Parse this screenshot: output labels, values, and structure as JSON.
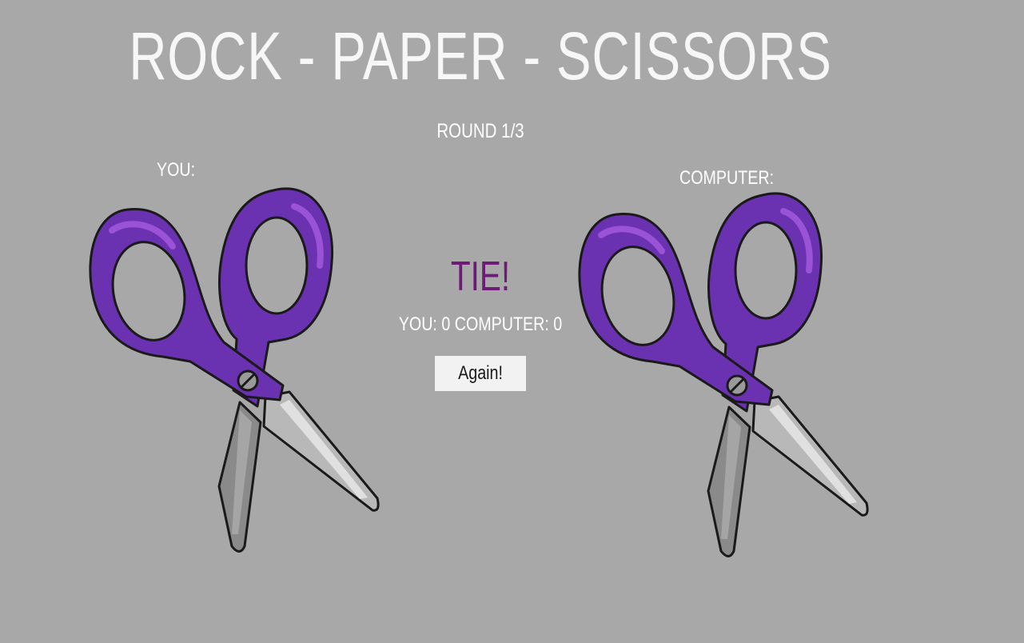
{
  "game": {
    "title": "ROCK - PAPER - SCISSORS",
    "round": "ROUND 1/3",
    "result": "TIE!",
    "score_text": "YOU: 0 COMPUTER: 0",
    "again_label": "Again!"
  },
  "players": {
    "you": {
      "label": "YOU:",
      "choice": "scissors-icon"
    },
    "computer": {
      "label": "COMPUTER:",
      "choice": "scissors-icon"
    }
  },
  "colors": {
    "background": "#a8a8a8",
    "result": "#6e1a78",
    "handle": "#6a32b0",
    "handle_highlight": "#9a52d6",
    "blade": "#b8b8b8"
  }
}
